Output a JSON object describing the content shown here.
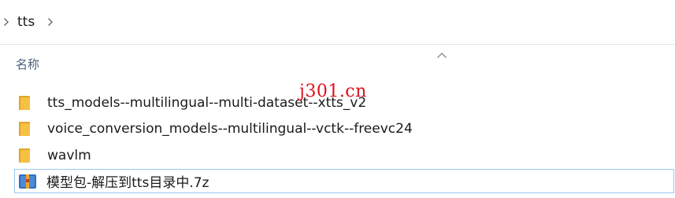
{
  "address_bar": {
    "path_segment": "tts"
  },
  "columns": {
    "name_header": "名称",
    "sort_direction": "ascending"
  },
  "files": [
    {
      "name": "tts_models--multilingual--multi-dataset--xtts_v2",
      "type": "folder",
      "selected": false
    },
    {
      "name": "voice_conversion_models--multilingual--vctk--freevc24",
      "type": "folder",
      "selected": false
    },
    {
      "name": "wavlm",
      "type": "folder",
      "selected": false
    },
    {
      "name": "模型包-解压到tts目录中.7z",
      "type": "archive",
      "selected": true
    }
  ],
  "watermark": {
    "text": "j301.cn",
    "color": "#e0101a"
  },
  "colors": {
    "folder_yellow": "#f6c142",
    "folder_dark": "#e0a526",
    "selection_border": "#99c9ef",
    "header_text": "#4c607a"
  }
}
